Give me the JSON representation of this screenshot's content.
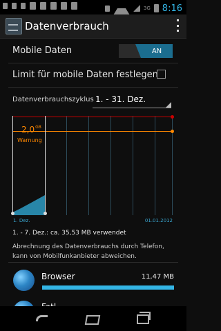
{
  "statusbar": {
    "time": "8:16",
    "network_label": "3G"
  },
  "header": {
    "title": "Datenverbrauch"
  },
  "settings": {
    "mobile_data": {
      "label": "Mobile Daten",
      "toggle_value": "AN"
    },
    "limit": {
      "label": "Limit für mobile Daten festlegen"
    }
  },
  "cycle": {
    "label": "Datenverbrauchszyklus",
    "value": "1. - 31. Dez."
  },
  "chart_data": {
    "type": "area",
    "warning": {
      "value": "2,0",
      "unit": "GB",
      "label": "Warnung"
    },
    "axis": {
      "start_label": "1. Dez.",
      "end_label": "01.01.2012"
    }
  },
  "summary": {
    "usage_text": "1. - 7. Dez.: ca. 35,53 MB verwendet",
    "footnote": "Abrechnung des Datenverbrauchs durch Telefon, kann von Mobilfunkanbieter abweichen."
  },
  "apps": [
    {
      "name": "Browser",
      "size": "11,47 MB",
      "usage_fraction": 1.0,
      "icon": "browser-icon"
    },
    {
      "name": "Fatl",
      "size": "",
      "icon": "app-icon"
    }
  ],
  "colors": {
    "accent": "#33b5e5",
    "warning": "#ff8800",
    "limit": "#cc0000"
  }
}
